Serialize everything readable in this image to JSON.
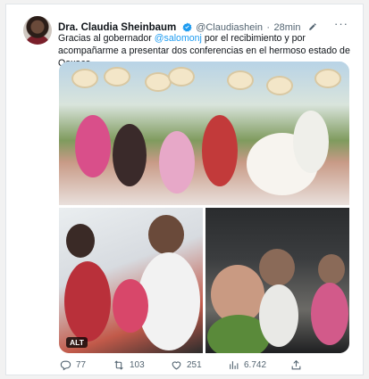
{
  "tweet": {
    "author_name": "Dra. Claudia Sheinbaum",
    "handle": "@Claudiashein",
    "separator": "·",
    "time": "28min",
    "text_before": "Gracias al gobernador ",
    "mention": "@salomonj",
    "text_after": " por el recibimiento y por acompañarme a presentar dos conferencias en el hermoso estado de Oaxaca.",
    "alt_badge": "ALT"
  },
  "actions": {
    "replies": "77",
    "retweets": "103",
    "likes": "251",
    "views": "6.742"
  },
  "colors": {
    "verified": "#1d9bf0",
    "mention": "#1d9bf0",
    "muted": "#536471"
  }
}
